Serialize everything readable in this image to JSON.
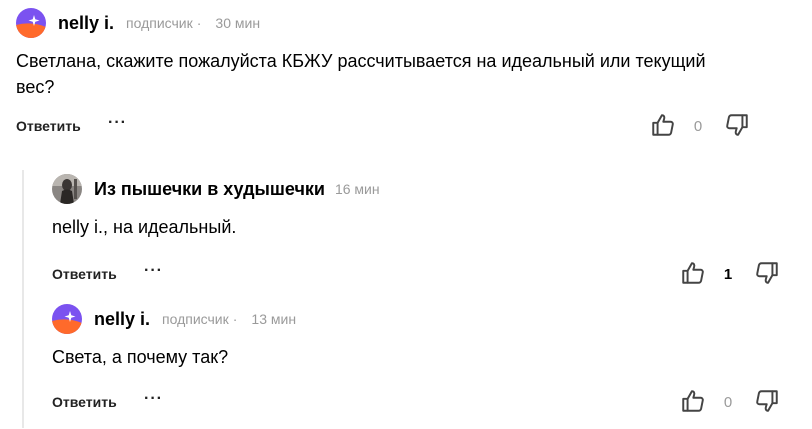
{
  "colors": {
    "subtle": "#9a9a9a",
    "avatar_purple": "#7b52f0",
    "avatar_orange": "#ff6a2b",
    "thread_line": "#e8e8e8"
  },
  "comments": [
    {
      "author": "nelly i.",
      "status": "подписчик",
      "separator": "·",
      "time": "30 мин",
      "text": "Светлана, скажите пожалуйста КБЖУ рассчитывается на идеальный или текущий вес?",
      "reply_label": "Ответить",
      "more_label": "···",
      "votes": "0",
      "avatar_icon": "nelly-avatar-icon"
    },
    {
      "author": "Из пышечки в худышечки",
      "time": "16 мин",
      "text": "nelly i., на идеальный.",
      "reply_label": "Ответить",
      "more_label": "···",
      "votes": "1",
      "avatar_icon": "photo-avatar"
    },
    {
      "author": "nelly i.",
      "status": "подписчик",
      "separator": "·",
      "time": "13 мин",
      "text": "Света, а почему так?",
      "reply_label": "Ответить",
      "more_label": "···",
      "votes": "0",
      "avatar_icon": "nelly-avatar-icon"
    }
  ]
}
